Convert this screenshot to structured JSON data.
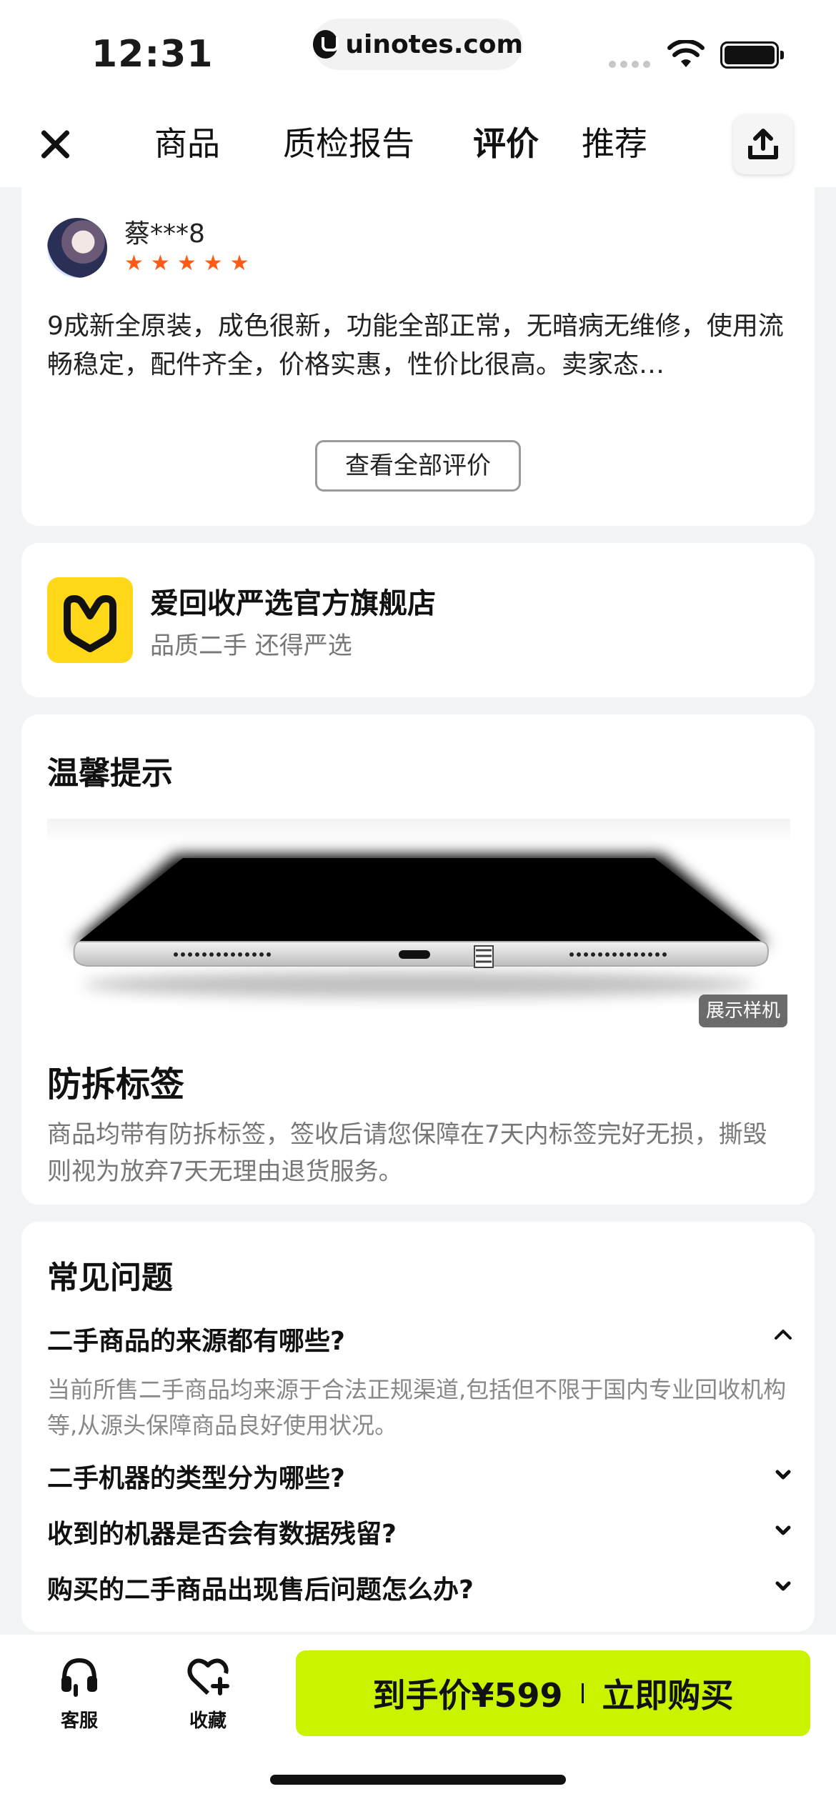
{
  "status_bar": {
    "time": "12:31",
    "url": "uinotes.com"
  },
  "nav": {
    "tabs": [
      {
        "label": "商品",
        "active": false
      },
      {
        "label": "质检报告",
        "active": false
      },
      {
        "label": "评价",
        "active": true
      },
      {
        "label": "推荐",
        "active": false
      }
    ],
    "accent_color": "#c8f400",
    "close_icon": "close-icon",
    "share_icon": "share-icon"
  },
  "review": {
    "reviewer_name": "蔡***8",
    "rating": 5,
    "text": "9成新全原装，成色很新，功能全部正常，无暗病无维修，使用流畅稳定，配件齐全，价格实惠，性价比很高。卖家态…",
    "view_all_label": "查看全部评价",
    "star_color": "#ff5b14"
  },
  "store": {
    "name": "爱回收严选官方旗舰店",
    "slogan": "品质二手 还得严选",
    "logo_color": "#ffd81a"
  },
  "tips": {
    "title": "温馨提示",
    "image_badge": "展示样机",
    "tag_title": "防拆标签",
    "tag_text": "商品均带有防拆标签，签收后请您保障在7天内标签完好无损，撕毁则视为放弃7天无理由退货服务。"
  },
  "faq": {
    "title": "常见问题",
    "items": [
      {
        "question": "二手商品的来源都有哪些?",
        "expanded": true,
        "answer": "当前所售二手商品均来源于合法正规渠道,包括但不限于国内专业回收机构等,从源头保障商品良好使用状况。"
      },
      {
        "question": "二手机器的类型分为哪些?",
        "expanded": false
      },
      {
        "question": "收到的机器是否会有数据残留?",
        "expanded": false
      },
      {
        "question": "购买的二手商品出现售后问题怎么办?",
        "expanded": false
      }
    ]
  },
  "bottom_bar": {
    "service_label": "客服",
    "favorite_label": "收藏",
    "price_label": "到手价¥599",
    "buy_label": "立即购买",
    "button_color": "#c8f400"
  }
}
